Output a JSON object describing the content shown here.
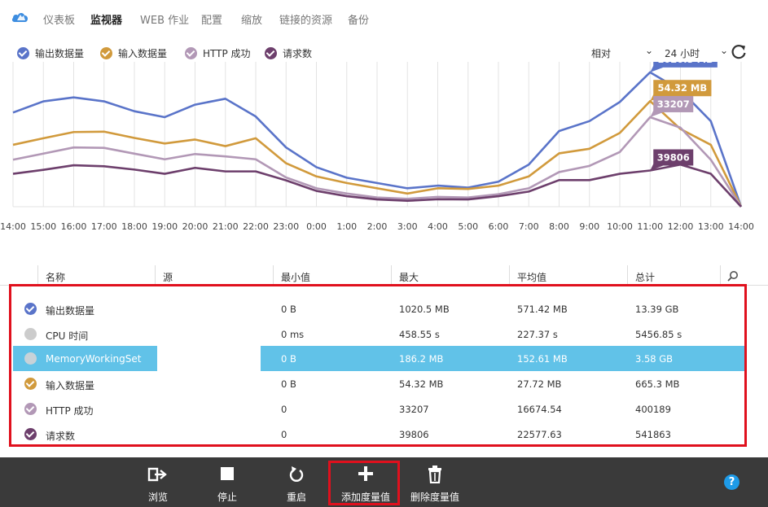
{
  "nav": {
    "tabs": [
      "仪表板",
      "监视器",
      "WEB 作业",
      "配置",
      "缩放",
      "链接的资源",
      "备份"
    ],
    "active": "监视器"
  },
  "legend": [
    {
      "label": "输出数据量",
      "color": "#5a74c9",
      "checked": true
    },
    {
      "label": "输入数据量",
      "color": "#d19a3c",
      "checked": true
    },
    {
      "label": "HTTP 成功",
      "color": "#b298b6",
      "checked": true
    },
    {
      "label": "请求数",
      "color": "#6d3f6c",
      "checked": true
    }
  ],
  "controls": {
    "mode": "相对",
    "range": "24 小时",
    "refresh_icon": "refresh-icon"
  },
  "chart_data": {
    "type": "line",
    "x": [
      "14:00",
      "15:00",
      "16:00",
      "17:00",
      "18:00",
      "19:00",
      "20:00",
      "21:00",
      "22:00",
      "23:00",
      "0:00",
      "1:00",
      "2:00",
      "3:00",
      "4:00",
      "5:00",
      "6:00",
      "7:00",
      "8:00",
      "9:00",
      "10:00",
      "11:00",
      "12:00",
      "13:00",
      "14:00"
    ],
    "series": [
      {
        "name": "输出数据量",
        "color": "#5a74c9",
        "values": [
          715,
          800,
          830,
          800,
          725,
          680,
          775,
          820,
          685,
          450,
          300,
          220,
          180,
          140,
          160,
          145,
          190,
          320,
          575,
          650,
          795,
          1020.5,
          885,
          650,
          0
        ]
      },
      {
        "name": "输入数据量",
        "color": "#d19a3c",
        "values": [
          470,
          520,
          567,
          570,
          522,
          480,
          510,
          460,
          520,
          330,
          230,
          180,
          140,
          100,
          140,
          135,
          160,
          230,
          405,
          440,
          560,
          802,
          590,
          470,
          0
        ]
      },
      {
        "name": "HTTP 成功",
        "color": "#b298b6",
        "values": [
          357,
          403,
          450,
          447,
          403,
          360,
          400,
          382,
          360,
          222,
          140,
          100,
          70,
          60,
          75,
          70,
          95,
          140,
          263,
          310,
          415,
          680,
          600,
          357,
          0
        ]
      },
      {
        "name": "请求数",
        "color": "#6d3f6c",
        "values": [
          250,
          280,
          315,
          307,
          282,
          250,
          295,
          268,
          268,
          200,
          120,
          80,
          55,
          45,
          57,
          55,
          80,
          115,
          202,
          202,
          250,
          275,
          320,
          250,
          0
        ]
      }
    ],
    "callouts": [
      "1020.5 MB",
      "54.32 MB",
      "33207",
      "39806"
    ],
    "ylim": [
      0,
      1100
    ],
    "grid": true
  },
  "table": {
    "headers": [
      "名称",
      "源",
      "最小值",
      "最大",
      "平均值",
      "总计"
    ],
    "rows": [
      {
        "name": "输出数据量",
        "color": "#5a74c9",
        "checked": true,
        "min": "0 B",
        "max": "1020.5 MB",
        "avg": "571.42 MB",
        "total": "13.39 GB",
        "selected": false
      },
      {
        "name": "CPU 时间",
        "color": "#c8c8c8",
        "checked": false,
        "min": "0 ms",
        "max": "458.55 s",
        "avg": "227.37 s",
        "total": "5456.85 s",
        "selected": false
      },
      {
        "name": "MemoryWorkingSet",
        "color": "#c8c8c8",
        "checked": false,
        "min": "0 B",
        "max": "186.2 MB",
        "avg": "152.61 MB",
        "total": "3.58 GB",
        "selected": true
      },
      {
        "name": "输入数据量",
        "color": "#d19a3c",
        "checked": true,
        "min": "0 B",
        "max": "54.32 MB",
        "avg": "27.72 MB",
        "total": "665.3 MB",
        "selected": false
      },
      {
        "name": "HTTP 成功",
        "color": "#b298b6",
        "checked": true,
        "min": "0",
        "max": "33207",
        "avg": "16674.54",
        "total": "400189",
        "selected": false
      },
      {
        "name": "请求数",
        "color": "#6d3f6c",
        "checked": true,
        "min": "0",
        "max": "39806",
        "avg": "22577.63",
        "total": "541863",
        "selected": false
      }
    ]
  },
  "toolbar": {
    "browse": "浏览",
    "stop": "停止",
    "restart": "重启",
    "add_metric": "添加度量值",
    "delete_metric": "删除度量值",
    "help": "?"
  },
  "colors": {
    "selection": "#61c2e8",
    "highlight": "#e0101d",
    "bottombar": "#3a3a3a"
  }
}
